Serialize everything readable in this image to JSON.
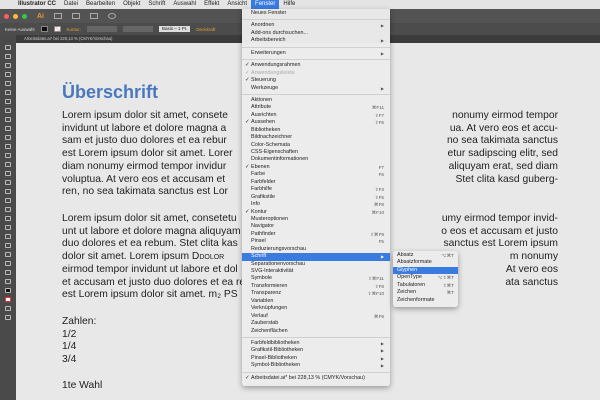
{
  "menubar": {
    "apple": "",
    "items": [
      "Illustrator CC",
      "Datei",
      "Bearbeiten",
      "Objekt",
      "Schrift",
      "Auswahl",
      "Effekt",
      "Ansicht",
      "Fenster",
      "Hilfe"
    ],
    "active": "Fenster"
  },
  "control": {
    "selection": "Keine Auswahl",
    "stroke_label": "Kontur:",
    "brush": "Basis – 1 Pt.",
    "opacity_label": "Deckkraft"
  },
  "app": {
    "logo": "Ai"
  },
  "tab": {
    "title": "Arbeitsdatei.ai* bei 228,13 % (CMYK/Vorschau)"
  },
  "document": {
    "heading": "Überschrift",
    "para1": [
      [
        "Lorem ipsum dolor sit amet, consete",
        "nonumy eirmod tempor"
      ],
      [
        "invidunt ut labore et dolore magna a",
        "ua. At vero eos et accu-"
      ],
      [
        "sam et justo duo dolores et ea rebur",
        "no sea takimata sanctus"
      ],
      [
        "est Lorem ipsum dolor sit amet. Lorer",
        "etur sadipscing elitr, sed"
      ],
      [
        "diam nonumy eirmod tempor invidur",
        "aliquyam erat, sed diam"
      ],
      [
        "voluptua. At vero eos et accusam et",
        "Stet clita kasd guberg-"
      ],
      [
        "ren, no sea takimata sanctus est Lor",
        ""
      ]
    ],
    "para2": [
      [
        "Lorem ipsum dolor sit amet, consetetu",
        "umy eirmod tempor invid-"
      ],
      [
        "unt ut labore et dolore magna aliquyam",
        "o eos et accusam et justo"
      ],
      [
        "duo dolores et ea rebum. Stet clita kas",
        "sanctus est Lorem ipsum"
      ],
      [
        "dolor sit amet. Lorem ipsum Ddolor",
        "m nonumy"
      ],
      [
        "eirmod tempor invidunt ut labore et dol",
        "At vero eos"
      ],
      [
        "et accusam et justo duo dolores et ea re",
        "ata sanctus"
      ],
      [
        "est Lorem ipsum dolor sit amet. m₂ PS",
        ""
      ]
    ],
    "list": [
      "Zahlen:",
      "1/2",
      "1/4",
      "3/4"
    ],
    "last": "1te Wahl"
  },
  "window_menu": [
    {
      "label": "Neues Fenster"
    },
    {
      "sep": true
    },
    {
      "label": "Anordnen",
      "sub": true
    },
    {
      "label": "Add-ons durchsuchen..."
    },
    {
      "label": "Arbeitsbereich",
      "sub": true
    },
    {
      "sep": true
    },
    {
      "label": "Erweiterungen",
      "sub": true
    },
    {
      "sep": true
    },
    {
      "label": "Anwendungsrahmen",
      "check": true
    },
    {
      "label": "Anwendungsleiste",
      "check": true,
      "disabled": true
    },
    {
      "label": "Steuerung",
      "check": true
    },
    {
      "label": "Werkzeuge",
      "sub": true
    },
    {
      "sep": true
    },
    {
      "label": "Aktionen"
    },
    {
      "label": "Attribute",
      "shortcut": "⌘F11"
    },
    {
      "label": "Ausrichten",
      "shortcut": "⇧F7"
    },
    {
      "label": "Aussehen",
      "check": true,
      "shortcut": "⇧F6"
    },
    {
      "label": "Bibliotheken"
    },
    {
      "label": "Bildnachzeichner"
    },
    {
      "label": "Color-Schemata"
    },
    {
      "label": "CSS-Eigenschaften"
    },
    {
      "label": "Dokumentinformationen"
    },
    {
      "label": "Ebenen",
      "check": true,
      "shortcut": "F7"
    },
    {
      "label": "Farbe",
      "shortcut": "F6"
    },
    {
      "label": "Farbfelder"
    },
    {
      "label": "Farbhilfe",
      "shortcut": "⇧F3"
    },
    {
      "label": "Grafikstile",
      "shortcut": "⇧F5"
    },
    {
      "label": "Info",
      "shortcut": "⌘F8"
    },
    {
      "label": "Kontur",
      "check": true,
      "shortcut": "⌘F10"
    },
    {
      "label": "Musteroptionen"
    },
    {
      "label": "Navigator"
    },
    {
      "label": "Pathfinder",
      "shortcut": "⇧⌘F9"
    },
    {
      "label": "Pinsel",
      "shortcut": "F5"
    },
    {
      "label": "Reduzierungsvorschau"
    },
    {
      "label": "Schrift",
      "sub": true,
      "highlight": true
    },
    {
      "label": "Separationenvorschau"
    },
    {
      "label": "SVG-Interaktivität"
    },
    {
      "label": "Symbole",
      "shortcut": "⇧⌘F11"
    },
    {
      "label": "Transformieren",
      "shortcut": "⇧F8"
    },
    {
      "label": "Transparenz",
      "shortcut": "⇧⌘F10"
    },
    {
      "label": "Variablen"
    },
    {
      "label": "Verknüpfungen"
    },
    {
      "label": "Verlauf",
      "shortcut": "⌘F9"
    },
    {
      "label": "Zauberstab"
    },
    {
      "label": "Zeichenflächen"
    },
    {
      "sep": true
    },
    {
      "label": "Farbfeldbibliotheken",
      "sub": true
    },
    {
      "label": "Grafikstil-Bibliotheken",
      "sub": true
    },
    {
      "label": "Pinsel-Bibliotheken",
      "sub": true
    },
    {
      "label": "Symbol-Bibliotheken",
      "sub": true
    },
    {
      "sep": true
    },
    {
      "label": "Arbeitsdatei.ai* bei 228,13 % (CMYK/Vorschau)",
      "check": true
    }
  ],
  "type_submenu": [
    {
      "label": "Absatz",
      "shortcut": "⌥⌘T"
    },
    {
      "label": "Absatzformate"
    },
    {
      "label": "Glyphen",
      "highlight": true
    },
    {
      "label": "OpenType",
      "shortcut": "⌥⇧⌘T"
    },
    {
      "label": "Tabulatoren",
      "shortcut": "⇧⌘T"
    },
    {
      "label": "Zeichen",
      "shortcut": "⌘T"
    },
    {
      "label": "Zeichenformate"
    }
  ],
  "colors": {
    "accent": "#3a7be0",
    "heading": "#4a78bf"
  }
}
